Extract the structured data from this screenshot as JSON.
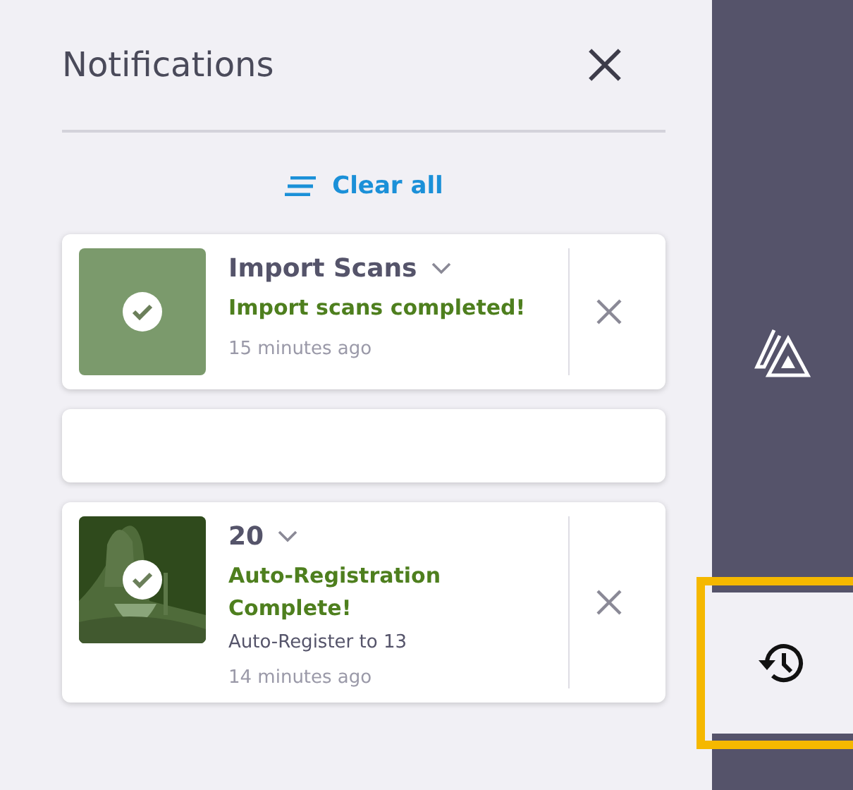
{
  "panel": {
    "title": "Notifications",
    "clear_all": "Clear all"
  },
  "notifications": [
    {
      "kind": "plain",
      "title": "Import Scans",
      "message": "Import scans completed!",
      "time": "15 minutes ago"
    },
    {
      "kind": "redacted"
    },
    {
      "kind": "picture",
      "title": "20",
      "message": "Auto-Registration Complete!",
      "detail": "Auto-Register to 13",
      "time": "14 minutes ago"
    }
  ],
  "sidebar": {
    "items": [
      {
        "kind": "triangles",
        "selected": false
      },
      {
        "kind": "history",
        "selected": true
      }
    ]
  }
}
